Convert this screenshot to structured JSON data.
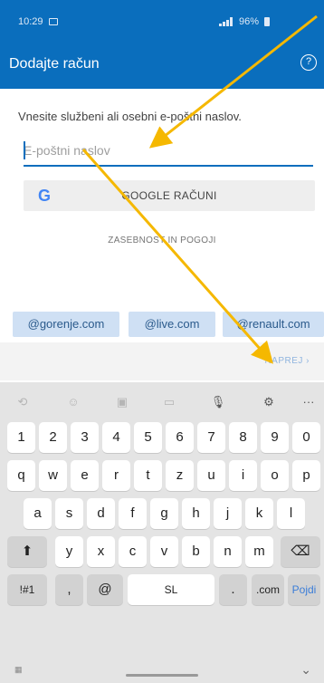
{
  "status": {
    "time": "10:29",
    "battery": "96%"
  },
  "appbar": {
    "title": "Dodajte račun",
    "help_glyph": "?"
  },
  "instruction": "Vnesite službeni ali osebni e-poštni naslov.",
  "email": {
    "placeholder": "E-poštni naslov",
    "value": ""
  },
  "google": {
    "logo": "G",
    "label": "GOOGLE RAČUNI"
  },
  "privacy": "ZASEBNOST IN POGOJI",
  "suggestions": [
    "@gorenje.com",
    "@live.com",
    "@renault.com"
  ],
  "next": "NAPREJ ›",
  "keyboard": {
    "numbers": [
      "1",
      "2",
      "3",
      "4",
      "5",
      "6",
      "7",
      "8",
      "9",
      "0"
    ],
    "row1": [
      "q",
      "w",
      "e",
      "r",
      "t",
      "z",
      "u",
      "i",
      "o",
      "p"
    ],
    "row2": [
      "a",
      "s",
      "d",
      "f",
      "g",
      "h",
      "j",
      "k",
      "l"
    ],
    "row3": [
      "y",
      "x",
      "c",
      "v",
      "b",
      "n",
      "m"
    ],
    "shift": "⬆",
    "backspace": "⌫",
    "symbols": "!#1",
    "comma": ",",
    "at": "@",
    "space": "SL",
    "period": ".",
    "dotcom": ".com",
    "action": "Pojdi"
  },
  "colors": {
    "brand": "#0a6ebd",
    "arrow": "#f5b800"
  }
}
